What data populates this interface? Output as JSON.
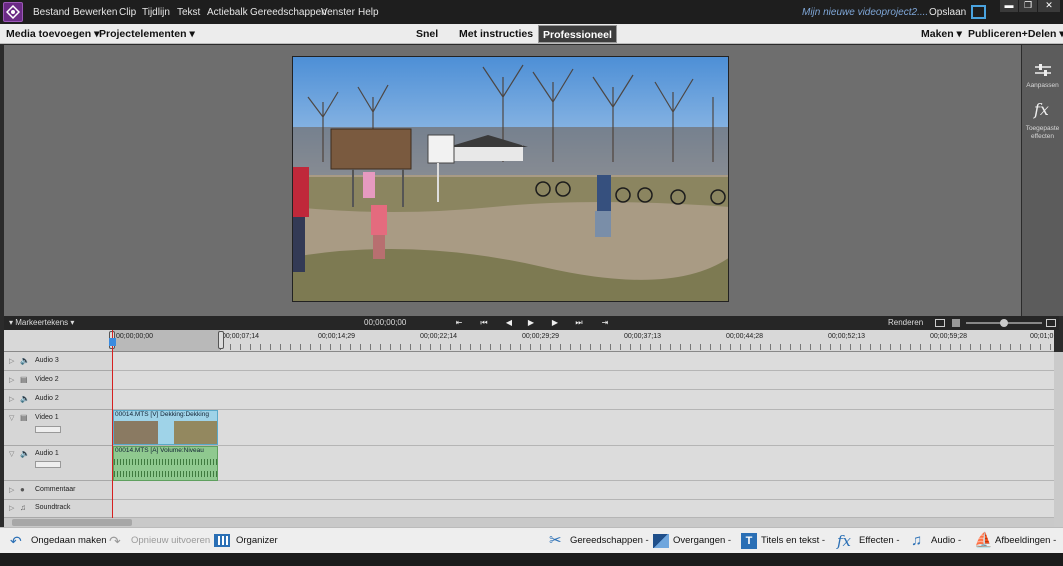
{
  "menubar": {
    "items": [
      "Bestand",
      "Bewerken",
      "Clip",
      "Tijdlijn",
      "Tekst",
      "Actiebalk",
      "Gereedschappen",
      "Venster",
      "Help"
    ],
    "project_title": "Mijn nieuwe videoproject2....",
    "save": "Opslaan",
    "window_buttons": [
      "▬",
      "❐",
      "✕"
    ]
  },
  "modebar": {
    "add_media": "Media toevoegen",
    "project_assets": "Projectelementen",
    "quick": "Snel",
    "guided": "Met instructies",
    "expert": "Professioneel",
    "create": "Maken",
    "publish_share": "Publiceren+Delen"
  },
  "right_panel": {
    "adjust": "Aanpassen",
    "applied_effects_line1": "Toegepaste",
    "applied_effects_line2": "effecten"
  },
  "transport": {
    "markers": "Markeertekens",
    "timecode": "00;00;00;00",
    "render": "Renderen"
  },
  "ruler": {
    "labels": [
      "00;00;00;00",
      "00;00;07;14",
      "00;00;14;29",
      "00;00;22;14",
      "00;00;29;29",
      "00;00;37;13",
      "00;00;44;28",
      "00;00;52;13",
      "00;00;59;28",
      "00;01;0"
    ]
  },
  "tracks": [
    {
      "name": "Audio 3"
    },
    {
      "name": "Video 2"
    },
    {
      "name": "Audio 2"
    },
    {
      "name": "Video 1"
    },
    {
      "name": "Audio 1"
    },
    {
      "name": "Commentaar"
    },
    {
      "name": "Soundtrack"
    }
  ],
  "clips": {
    "video": "00014.MTS [V] Dekking:Dekking",
    "audio": "00014.MTS [A] Volume:Niveau"
  },
  "bottombar": {
    "undo": "Ongedaan maken",
    "redo": "Opnieuw uitvoeren",
    "organizer": "Organizer",
    "tools": "Gereedschappen",
    "transitions": "Overgangen",
    "titles": "Titels en tekst",
    "effects": "Effecten",
    "audio": "Audio",
    "graphics": "Afbeeldingen"
  },
  "colors": {
    "accent_blue": "#4aa3df",
    "playhead": "#d62020",
    "video_clip": "#9fd3e8",
    "audio_clip": "#8fc98f"
  }
}
